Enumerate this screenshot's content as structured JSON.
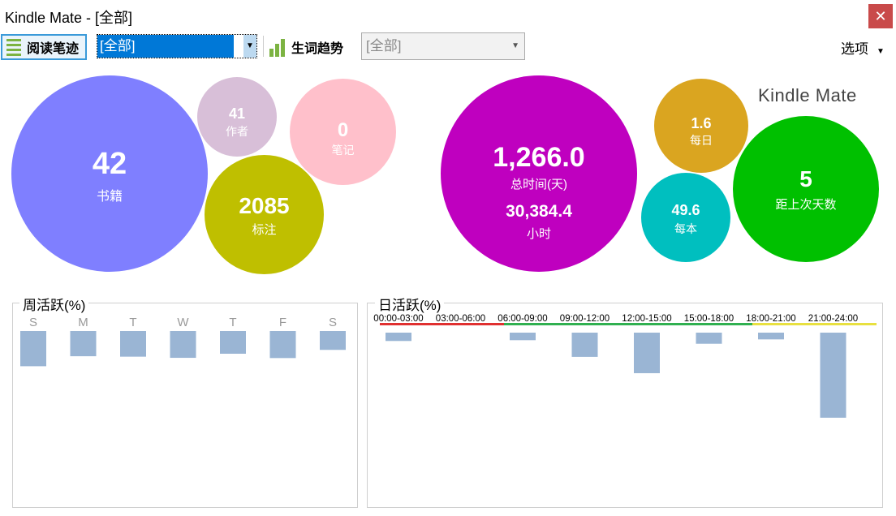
{
  "window": {
    "title": "Kindle Mate - [全部]",
    "close_glyph": "✕"
  },
  "toolbar": {
    "reading_label": "阅读笔迹",
    "reading_filter": "[全部]",
    "words_label": "生词趋势",
    "words_filter": "[全部]",
    "options_label": "选项"
  },
  "brand": "Kindle Mate",
  "stats_left": {
    "books": {
      "value": "42",
      "label": "书籍",
      "color": "#7f7fff"
    },
    "authors": {
      "value": "41",
      "label": "作者",
      "color": "#d8bfd8"
    },
    "notes": {
      "value": "0",
      "label": "笔记",
      "color": "#ffc0cb"
    },
    "highlights": {
      "value": "2085",
      "label": "标注",
      "color": "#bfbf00"
    }
  },
  "stats_right": {
    "total_time": {
      "value": "1,266.0",
      "label": "总时间(天)",
      "hours": "30,384.4",
      "hours_label": "小时",
      "color": "#bf00bf"
    },
    "daily": {
      "value": "1.6",
      "label": "每日",
      "color": "#daa520"
    },
    "per_book": {
      "value": "49.6",
      "label": "每本",
      "color": "#00bfbf"
    },
    "days_since": {
      "value": "5",
      "label": "距上次天数",
      "color": "#00c000"
    }
  },
  "weekly": {
    "title": "周活跃(%)",
    "chart_data": {
      "type": "bar",
      "categories": [
        "S",
        "M",
        "T",
        "W",
        "T",
        "F",
        "S"
      ],
      "values": [
        15.5,
        11.1,
        11.3,
        11.8,
        10.0,
        11.9,
        8.3
      ],
      "bar_color": "#9ab5d4"
    }
  },
  "daily_chart": {
    "title": "日活跃(%)",
    "chart_data": {
      "type": "bar",
      "categories": [
        "00:00-03:00",
        "03:00-06:00",
        "06:00-09:00",
        "09:00-12:00",
        "12:00-15:00",
        "15:00-18:00",
        "18:00-21:00",
        "21:00-24:00"
      ],
      "values": [
        2.1,
        0,
        1.9,
        6.1,
        10.2,
        2.8,
        1.7,
        21.4
      ],
      "bar_color": "#9ab5d4",
      "period_colors": [
        "#e03030",
        "#e03030",
        "#30b050",
        "#30b050",
        "#30b050",
        "#30b050",
        "#e8e040",
        "#e8e040"
      ]
    }
  }
}
